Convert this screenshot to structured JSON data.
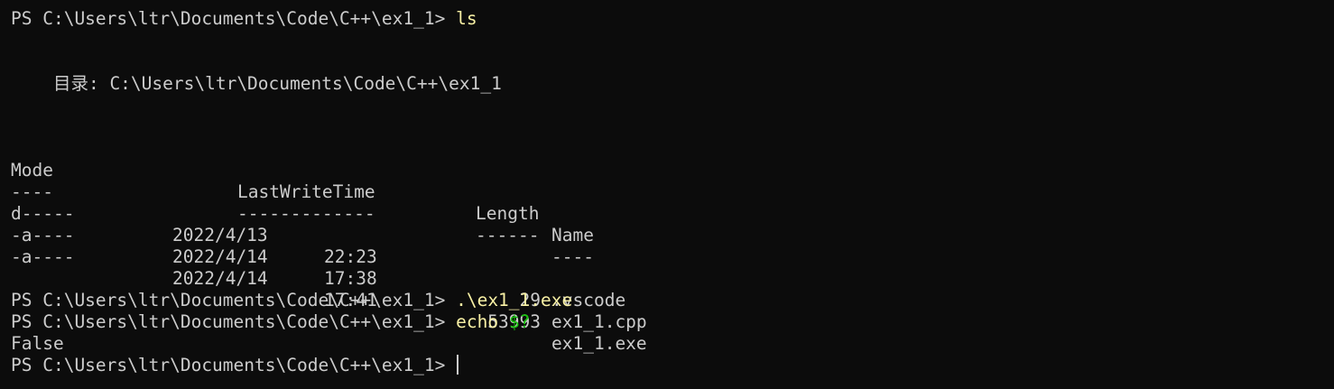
{
  "prompt": "PS C:\\Users\\ltr\\Documents\\Code\\C++\\ex1_1> ",
  "commands": [
    {
      "cmd": "ls",
      "arg": ""
    },
    {
      "cmd": ".\\ex1_1.exe",
      "arg": ""
    },
    {
      "cmd": "echo",
      "arg": "$?"
    }
  ],
  "directory_line": "    目录: C:\\Users\\ltr\\Documents\\Code\\C++\\ex1_1",
  "listing": {
    "headers": {
      "mode": "Mode",
      "last_write_time": "LastWriteTime",
      "length": "Length",
      "name": "Name"
    },
    "underlines": {
      "mode": "----",
      "last_write_time": "-------------",
      "length": "------",
      "name": "----"
    },
    "rows": [
      {
        "mode": "d-----",
        "date": "2022/4/13",
        "time": "22:23",
        "length": "",
        "name": ".vscode"
      },
      {
        "mode": "-a----",
        "date": "2022/4/14",
        "time": "17:38",
        "length": "29",
        "name": "ex1_1.cpp"
      },
      {
        "mode": "-a----",
        "date": "2022/4/14",
        "time": "17:41",
        "length": "53993",
        "name": "ex1_1.exe"
      }
    ]
  },
  "output_false": "False",
  "colors": {
    "background": "#0c0c0c",
    "text": "#cccccc",
    "command": "#f9f1a5",
    "argument": "#16c60c"
  }
}
